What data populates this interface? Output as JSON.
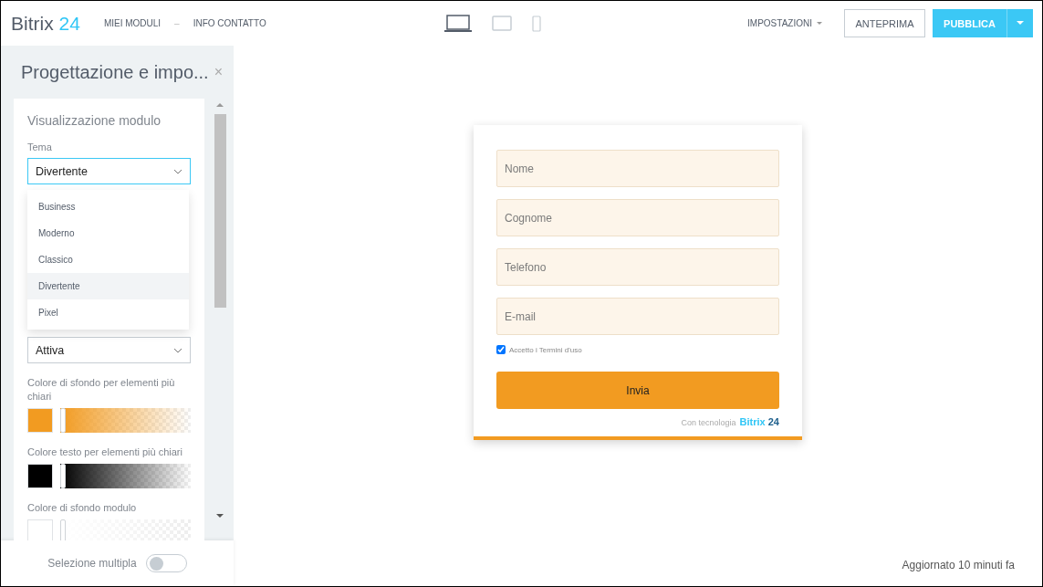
{
  "header": {
    "logo": {
      "name": "Bitrix",
      "number": "24"
    },
    "nav": [
      {
        "label": "MIEI MODULI"
      },
      {
        "label": "–"
      },
      {
        "label": "INFO CONTATTO"
      }
    ],
    "devices": [
      {
        "kind": "laptop",
        "selected": true
      },
      {
        "kind": "tablet",
        "selected": false
      },
      {
        "kind": "phone",
        "selected": false
      }
    ],
    "settings": "IMPOSTAZIONI",
    "preview": "ANTEPRIMA",
    "publish": "PUBBLICA"
  },
  "panel": {
    "title": "Progettazione e impo...",
    "close": "×",
    "section": "Visualizzazione modulo",
    "theme_label": "Tema",
    "theme_value": "Divertente",
    "theme_options": [
      {
        "label": "Business",
        "selected": false
      },
      {
        "label": "Moderno",
        "selected": false
      },
      {
        "label": "Classico",
        "selected": false
      },
      {
        "label": "Divertente",
        "selected": true
      },
      {
        "label": "Pixel",
        "selected": false
      }
    ],
    "second_select": "Attiva",
    "colors": [
      {
        "label": "Colore di sfondo per elementi più chiari",
        "color": "#f29b21",
        "level": 0
      },
      {
        "label": "Colore testo per elementi più chiari",
        "color": "#000000",
        "level": 0
      },
      {
        "label": "Colore di sfondo modulo",
        "color": "#ffffff",
        "level": 0
      }
    ],
    "multi_select": {
      "label": "Selezione multipla",
      "on": false
    }
  },
  "form": {
    "fields": [
      {
        "placeholder": "Nome"
      },
      {
        "placeholder": "Cognome"
      },
      {
        "placeholder": "Telefono"
      },
      {
        "placeholder": "E-mail"
      }
    ],
    "terms": {
      "label": "Accetto i Termini d'uso",
      "checked": true
    },
    "submit": "Invia",
    "powered": {
      "text": "Con tecnologia",
      "name": "Bitrix",
      "number": "24"
    }
  },
  "status": "Aggiornato 10 minuti fa"
}
